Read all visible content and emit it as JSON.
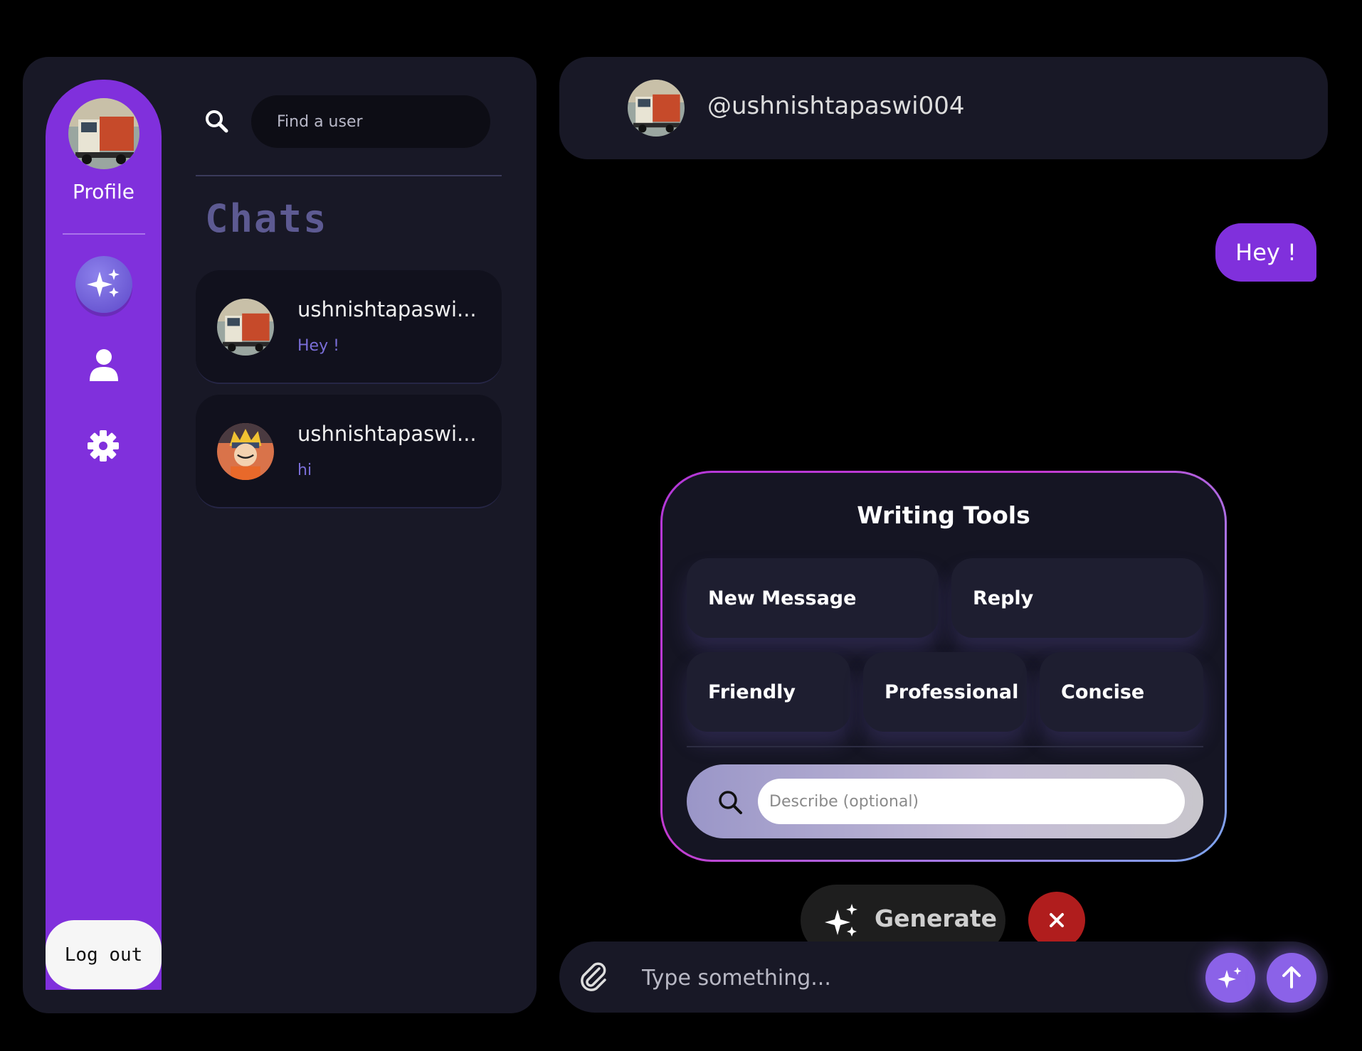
{
  "sidebar": {
    "profile_label": "Profile",
    "logout_label": "Log out"
  },
  "search": {
    "placeholder": "Find a user"
  },
  "chats": {
    "heading": "Chats",
    "items": [
      {
        "name": "ushnishtapaswi...",
        "preview": "Hey !"
      },
      {
        "name": "ushnishtapaswi...",
        "preview": "hi"
      }
    ]
  },
  "header": {
    "username": "@ushnishtapaswi004"
  },
  "messages": [
    {
      "text": "Hey !",
      "from": "me"
    }
  ],
  "writing_tools": {
    "title": "Writing Tools",
    "buttons": {
      "new_message": "New Message",
      "reply": "Reply",
      "friendly": "Friendly",
      "professional": "Professional",
      "concise": "Concise"
    },
    "describe_placeholder": "Describe (optional)"
  },
  "generate": {
    "label": "Generate"
  },
  "composer": {
    "placeholder": "Type something..."
  },
  "colors": {
    "accent": "#8030dc",
    "panel": "#181826",
    "close": "#b01d1d",
    "ai_button": "#8b62e8"
  },
  "icons": [
    "search-icon",
    "sparkle-icon",
    "user-icon",
    "gear-icon",
    "paperclip-icon",
    "close-icon",
    "arrow-up-icon"
  ]
}
